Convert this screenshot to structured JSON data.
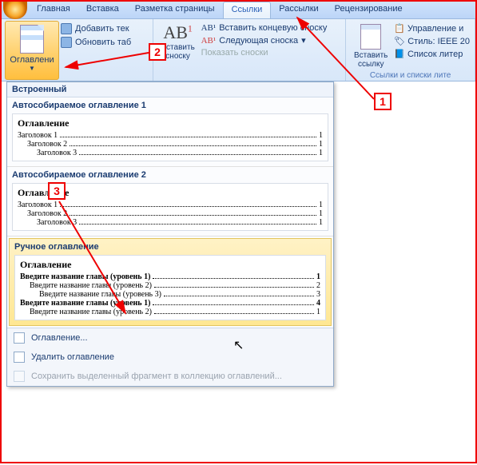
{
  "tabs": {
    "t0": "Главная",
    "t1": "Вставка",
    "t2": "Разметка страницы",
    "t3": "Ссылки",
    "t4": "Рассылки",
    "t5": "Рецензирование"
  },
  "ribbon": {
    "toc_btn": "Оглавлени",
    "add_text": "Добавить тек",
    "update": "Обновить таб",
    "footnote_btn_l1": "Вставить",
    "footnote_btn_l2": "сноску",
    "endnote": "Вставить концевую сноску",
    "next_fn": "Следующая сноска",
    "show_fn": "Показать сноски",
    "cite_btn_l1": "Вставить",
    "cite_btn_l2": "ссылку",
    "manage": "Управление и",
    "style_lbl": "Стиль:",
    "style_val": "IEEE 20",
    "biblio": "Список литер",
    "caption": "Ссылки и списки лите"
  },
  "dd": {
    "builtin": "Встроенный",
    "preset1": "Автособираемое оглавление 1",
    "preset2": "Автособираемое оглавление 2",
    "preset3": "Ручное оглавление",
    "toc_h": "Оглавление",
    "h1": "Заголовок 1",
    "h2": "Заголовок 2",
    "h3": "Заголовок 3",
    "m_l1": "Введите название главы (уровень 1)",
    "m_l2": "Введите название главы (уровень 2)",
    "m_l3": "Введите название главы (уровень 3)",
    "pg1": "1",
    "pg2": "2",
    "pg3": "3",
    "pg4": "4",
    "foot1": "Оглавление...",
    "foot2": "Удалить оглавление",
    "foot3": "Сохранить выделенный фрагмент в коллекцию оглавлений..."
  },
  "markers": {
    "m1": "1",
    "m2": "2",
    "m3": "3"
  }
}
